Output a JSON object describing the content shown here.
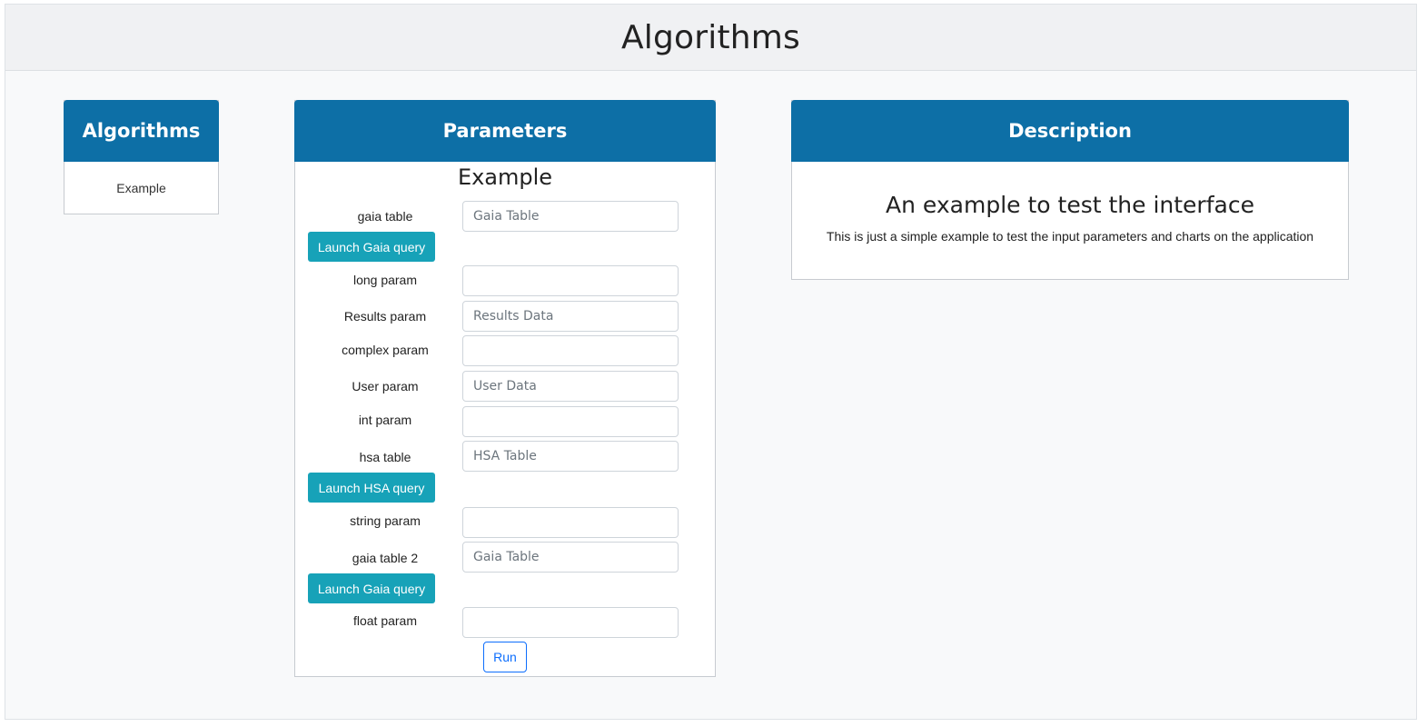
{
  "header": {
    "title": "Algorithms"
  },
  "algorithms_card": {
    "title": "Algorithms",
    "items": [
      {
        "label": "Example"
      }
    ]
  },
  "parameters_card": {
    "title": "Parameters",
    "algorithm_name": "Example",
    "fields": {
      "gaia_table": {
        "label": "gaia table",
        "value": "",
        "placeholder": "Gaia Table"
      },
      "long_param": {
        "label": "long param",
        "value": "",
        "placeholder": ""
      },
      "results_param": {
        "label": "Results param",
        "value": "",
        "placeholder": "Results Data"
      },
      "complex_param": {
        "label": "complex param",
        "value": "",
        "placeholder": ""
      },
      "user_param": {
        "label": "User param",
        "value": "",
        "placeholder": "User Data"
      },
      "int_param": {
        "label": "int param",
        "value": "",
        "placeholder": ""
      },
      "hsa_table": {
        "label": "hsa table",
        "value": "",
        "placeholder": "HSA Table"
      },
      "string_param": {
        "label": "string param",
        "value": "",
        "placeholder": ""
      },
      "gaia_table_2": {
        "label": "gaia table 2",
        "value": "",
        "placeholder": "Gaia Table"
      },
      "float_param": {
        "label": "float param",
        "value": "",
        "placeholder": ""
      }
    },
    "launch_gaia_label": "Launch Gaia query",
    "launch_hsa_label": "Launch HSA query",
    "launch_gaia_2_label": "Launch Gaia query",
    "run_label": "Run"
  },
  "description_card": {
    "title": "Description",
    "heading": "An example to test the interface",
    "text": "This is just a simple example to test the input parameters and charts on the application"
  },
  "colors": {
    "card_header": "#0d6fa6",
    "launch_button": "#17a2b8",
    "run_button_border": "#0d6efd"
  }
}
